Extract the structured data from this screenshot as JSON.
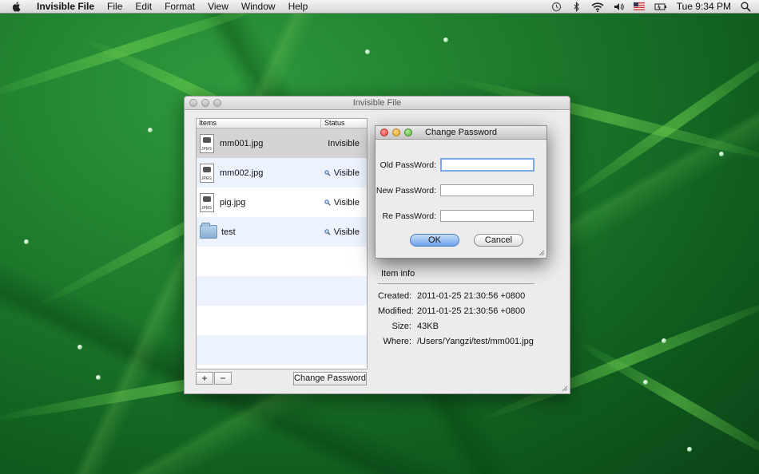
{
  "menubar": {
    "app_name": "Invisible File",
    "items": [
      "File",
      "Edit",
      "Format",
      "View",
      "Window",
      "Help"
    ],
    "clock": "Tue 9:34 PM",
    "status_icons": [
      "time-machine-icon",
      "bluetooth-icon",
      "wifi-icon",
      "volume-icon",
      "us-flag-icon",
      "battery-icon",
      "spotlight-icon"
    ]
  },
  "window": {
    "title": "Invisible File",
    "table": {
      "headers": [
        "Items",
        "Status"
      ],
      "rows": [
        {
          "name": "mm001.jpg",
          "status": "Invisible",
          "icon": "jpeg-file-icon"
        },
        {
          "name": "mm002.jpg",
          "status": "Visible",
          "icon": "jpeg-file-icon"
        },
        {
          "name": "pig.jpg",
          "status": "Visible",
          "icon": "jpeg-file-icon"
        },
        {
          "name": "test",
          "status": "Visible",
          "icon": "folder-icon"
        }
      ]
    },
    "add_label": "+",
    "remove_label": "−",
    "change_password_label": "Change Password",
    "item_info": {
      "title": "Item info",
      "rows": [
        {
          "key": "Created:",
          "value": "2011-01-25 21:30:56 +0800"
        },
        {
          "key": "Modified:",
          "value": "2011-01-25 21:30:56 +0800"
        },
        {
          "key": "Size:",
          "value": "43KB"
        },
        {
          "key": "Where:",
          "value": "/Users/Yangzi/test/mm001.jpg"
        }
      ]
    }
  },
  "dialog": {
    "title": "Change Password",
    "old_label": "Old PassWord:",
    "new_label": "New PassWord:",
    "re_label": "Re PassWord:",
    "old_value": "",
    "new_value": "",
    "re_value": "",
    "ok_label": "OK",
    "cancel_label": "Cancel"
  },
  "colors": {
    "ok_button": "#6ea3ea",
    "close_button": "#e0443e",
    "minimize_button": "#dea123",
    "zoom_button": "#59b23a",
    "selected_row": "#d4d4d4",
    "alt_row": "#edf3fe"
  }
}
